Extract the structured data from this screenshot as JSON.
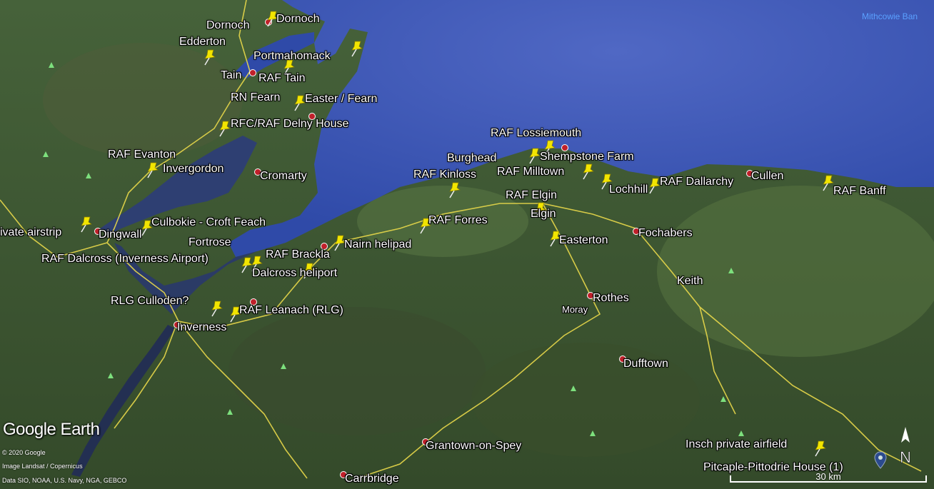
{
  "map": {
    "places": [
      {
        "id": "dornoch-1",
        "label": "Dornoch"
      },
      {
        "id": "dornoch-2",
        "label": "Dornoch"
      },
      {
        "id": "edderton",
        "label": "Edderton"
      },
      {
        "id": "portmahomack",
        "label": "Portmahomack"
      },
      {
        "id": "tain",
        "label": "Tain"
      },
      {
        "id": "raf-tain",
        "label": "RAF Tain"
      },
      {
        "id": "rn-fearn",
        "label": "RN Fearn"
      },
      {
        "id": "easter-fearn",
        "label": "Easter / Fearn"
      },
      {
        "id": "delny",
        "label": "RFC/RAF Delny House"
      },
      {
        "id": "raf-evanton",
        "label": "RAF Evanton"
      },
      {
        "id": "invergordon",
        "label": "Invergordon"
      },
      {
        "id": "cromarty",
        "label": "Cromarty"
      },
      {
        "id": "private-airstrip",
        "label": "ivate airstrip"
      },
      {
        "id": "dingwall",
        "label": "Dingwall"
      },
      {
        "id": "culbokie",
        "label": "Culbokie - Croft Feach"
      },
      {
        "id": "fortrose",
        "label": "Fortrose"
      },
      {
        "id": "raf-dalcross",
        "label": "RAF Dalcross (Inverness Airport)"
      },
      {
        "id": "raf-brackla",
        "label": "RAF Brackla"
      },
      {
        "id": "dalcross-heliport",
        "label": "Dalcross heliport"
      },
      {
        "id": "nairn-helipad",
        "label": "Nairn helipad"
      },
      {
        "id": "rlg-culloden",
        "label": "RLG Culloden?"
      },
      {
        "id": "raf-leanach",
        "label": "RAF Leanach (RLG)"
      },
      {
        "id": "inverness",
        "label": "Inverness"
      },
      {
        "id": "raf-lossiemouth",
        "label": "RAF Lossiemouth"
      },
      {
        "id": "burghead",
        "label": "Burghead"
      },
      {
        "id": "shempstone",
        "label": "Shempstone Farm"
      },
      {
        "id": "raf-kinloss",
        "label": "RAF Kinloss"
      },
      {
        "id": "raf-milltown",
        "label": "RAF Milltown"
      },
      {
        "id": "lochhill",
        "label": "Lochhill"
      },
      {
        "id": "raf-dallarchy",
        "label": "RAF Dallarchy"
      },
      {
        "id": "cullen",
        "label": "Cullen"
      },
      {
        "id": "raf-banff",
        "label": "RAF Banff"
      },
      {
        "id": "raf-elgin",
        "label": "RAF Elgin"
      },
      {
        "id": "elgin",
        "label": "Elgin"
      },
      {
        "id": "raf-forres",
        "label": "RAF Forres"
      },
      {
        "id": "easterton",
        "label": "Easterton"
      },
      {
        "id": "fochabers",
        "label": "Fochabers"
      },
      {
        "id": "keith",
        "label": "Keith"
      },
      {
        "id": "rothes",
        "label": "Rothes"
      },
      {
        "id": "moray",
        "label": "Moray"
      },
      {
        "id": "dufftown",
        "label": "Dufftown"
      },
      {
        "id": "grantown",
        "label": "Grantown-on-Spey"
      },
      {
        "id": "carrbridge",
        "label": "Carrbridge"
      },
      {
        "id": "insch",
        "label": "Insch private airfield"
      },
      {
        "id": "pitcaple",
        "label": "Pitcaple-Pittodrie House (1)"
      }
    ],
    "sea_label": "Mithcowie Ban",
    "logo": "Google Earth",
    "credits": [
      "© 2020 Google",
      "Image Landsat / Copernicus",
      "Data SIO, NOAA, U.S. Navy, NGA, GEBCO"
    ],
    "scale": "30 km",
    "north": "N",
    "colors": {
      "sea": "#3e59b4",
      "land": "#3f5a2f",
      "pin": "#f2e500",
      "road": "#e8d84a"
    }
  }
}
